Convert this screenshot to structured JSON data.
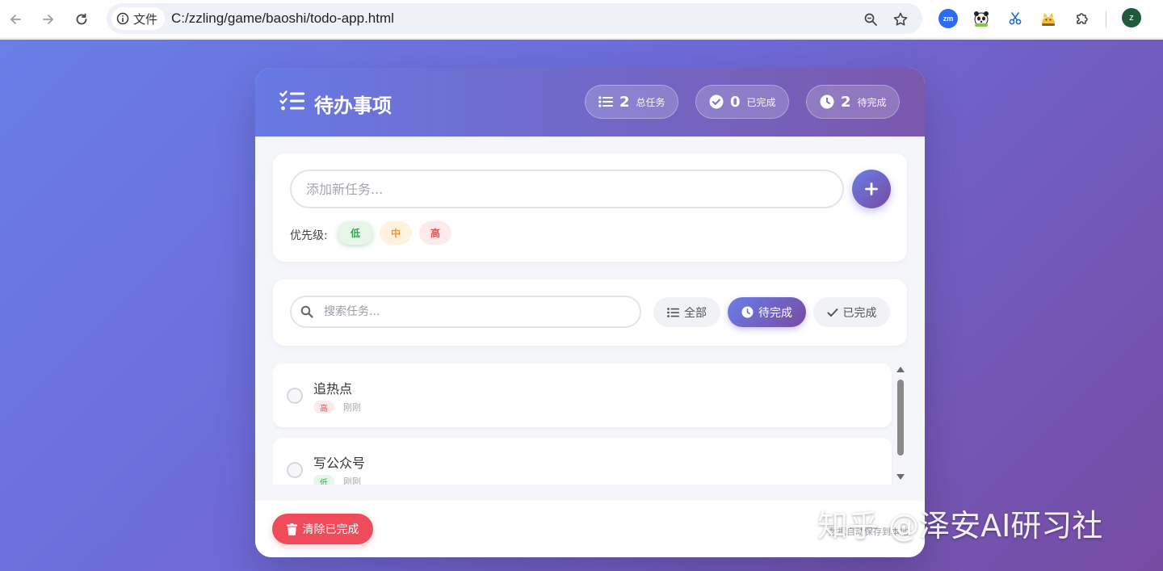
{
  "browser": {
    "info_chip_label": "文件",
    "url": "C:/zzling/game/baoshi/todo-app.html",
    "ext_zm_label": "zm",
    "avatar_letter": "z",
    "icons": [
      "back-icon",
      "forward-icon",
      "reload-icon",
      "info-icon",
      "zoom-icon",
      "star-icon",
      "puzzle-icon"
    ]
  },
  "header": {
    "title": "待办事项",
    "stats": [
      {
        "value": "2",
        "label": "总任务"
      },
      {
        "value": "0",
        "label": "已完成"
      },
      {
        "value": "2",
        "label": "待完成"
      }
    ]
  },
  "add": {
    "placeholder": "添加新任务...",
    "priority_label": "优先级:",
    "priorities": [
      "低",
      "中",
      "高"
    ],
    "selected_priority": "低"
  },
  "filter": {
    "search_placeholder": "搜索任务...",
    "buttons": [
      "全部",
      "待完成",
      "已完成"
    ],
    "active": "待完成"
  },
  "tasks": [
    {
      "text": "追热点",
      "priority": "高",
      "time": "刚刚"
    },
    {
      "text": "写公众号",
      "priority": "低",
      "time": "刚刚"
    }
  ],
  "footer": {
    "clear_label": "清除已完成",
    "note": "数据自动保存到本地"
  },
  "watermark": "知乎 @泽安AI研习社",
  "colors": {
    "accent_start": "#6a7ee8",
    "accent_end": "#764ba2",
    "danger": "#f04b5a",
    "low": "#3aa655",
    "mid": "#f0962a",
    "high": "#e55353"
  }
}
